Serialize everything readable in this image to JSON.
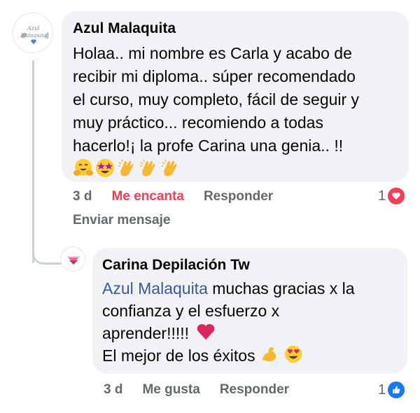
{
  "comment": {
    "author": "Azul Malaquita",
    "avatar_text": "Azul Malaquita",
    "lines": [
      "Holaa.. mi nombre es Carla y acabo de",
      "recibir mi diploma.. súper recomendado",
      "el curso, muy completo, fácil de seguir y",
      "muy práctico... recomiendo a todas",
      "hacerlo!¡ la profe Carina una genia.. !!"
    ],
    "emojis": [
      "hugging-face",
      "star-struck-face",
      "clapping-hands",
      "clapping-hands",
      "clapping-hands"
    ],
    "time": "3 d",
    "reaction_label": "Me encanta",
    "reply_label": "Responder",
    "send_message_label": "Enviar mensaje",
    "reaction_count": "1",
    "reaction_icon": "heart-icon"
  },
  "reply": {
    "author": "Carina Depilación Tw",
    "mention": "Azul Malaquita",
    "line1_rest": " muchas gracias x la",
    "line2": "confianza y el esfuerzo x",
    "line3": "aprender!!!!!",
    "line4": "El mejor de los éxitos",
    "time": "3 d",
    "reaction_label": "Me gusta",
    "reply_label": "Responder",
    "reaction_count": "1",
    "reaction_icon": "thumbs-up-icon"
  },
  "colors": {
    "bubble": "#f0f2f5",
    "love": "#f33e58",
    "like": "#1877f2",
    "muted": "#65676b",
    "mention": "#385898"
  }
}
